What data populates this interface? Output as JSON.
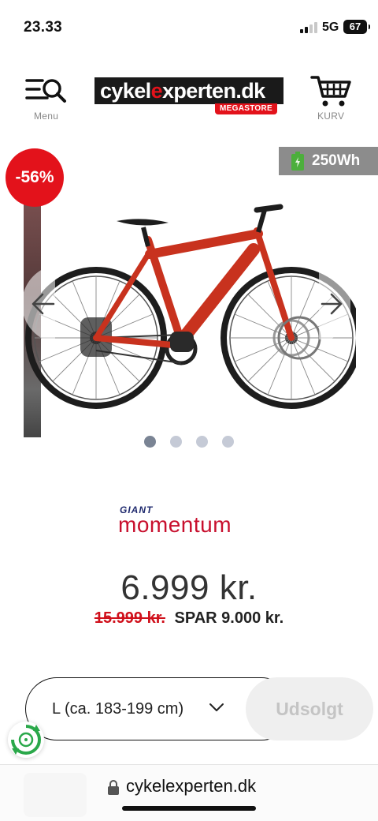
{
  "status_bar": {
    "time": "23.33",
    "network": "5G",
    "battery": "67"
  },
  "header": {
    "menu_label": "Menu",
    "cart_label": "KURV",
    "logo": {
      "prefix": "cykel",
      "accent": "e",
      "suffix": "xperten.dk",
      "sub": "MEGASTORE"
    }
  },
  "gallery": {
    "discount_badge": "-56%",
    "battery_badge": "250Wh",
    "slide_count": 4,
    "active_slide": 1,
    "bike_color": "#c8321e"
  },
  "product": {
    "brand_top": "GIANT",
    "brand_main": "momentum",
    "price": "6.999 kr.",
    "old_price": "15.999 kr.",
    "savings": "SPAR 9.000 kr."
  },
  "actions": {
    "size_value": "L (ca. 183-199 cm)",
    "soldout_label": "Udsolgt"
  },
  "browser": {
    "url": "cykelexperten.dk"
  },
  "colors": {
    "brand_red": "#e3121b",
    "dark": "#1a1a1a",
    "eco_green": "#2aa84a"
  }
}
